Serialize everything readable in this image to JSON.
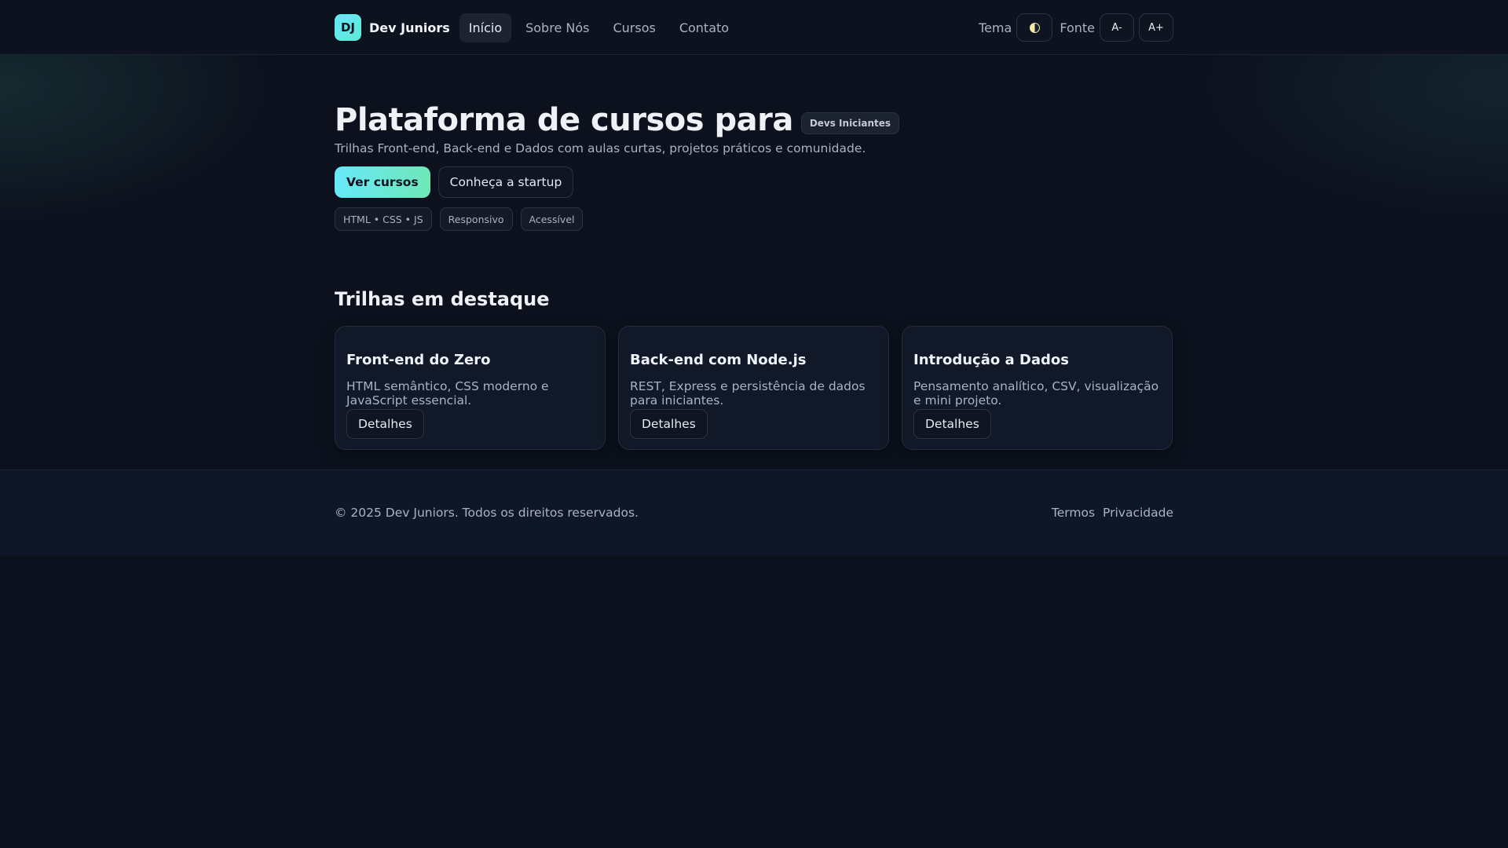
{
  "header": {
    "logo_text": "DJ",
    "brand": "Dev Juniors",
    "nav": [
      {
        "label": "Início"
      },
      {
        "label": "Sobre Nós"
      },
      {
        "label": "Cursos"
      },
      {
        "label": "Contato"
      }
    ],
    "theme_label": "Tema",
    "font_label": "Fonte",
    "font_decrease": "A-",
    "font_increase": "A+"
  },
  "hero": {
    "title": "Plataforma de cursos para",
    "badge": "Devs Iniciantes",
    "subtitle": "Trilhas Front-end, Back-end e Dados com aulas curtas, projetos práticos e comunidade.",
    "primary_button": "Ver cursos",
    "secondary_button": "Conheça a startup",
    "tags": [
      "HTML • CSS • JS",
      "Responsivo",
      "Acessível"
    ]
  },
  "featured": {
    "title": "Trilhas em destaque",
    "cards": [
      {
        "title": "Front-end do Zero",
        "desc": "HTML semântico, CSS moderno e JavaScript essencial.",
        "button": "Detalhes"
      },
      {
        "title": "Back-end com Node.js",
        "desc": "REST, Express e persistência de dados para iniciantes.",
        "button": "Detalhes"
      },
      {
        "title": "Introdução a Dados",
        "desc": "Pensamento analítico, CSV, visualização e mini projeto.",
        "button": "Detalhes"
      }
    ]
  },
  "footer": {
    "copyright": "© 2025 Dev Juniors. Todos os direitos reservados.",
    "links": [
      "Termos",
      "Privacidade"
    ]
  },
  "colors": {
    "background": "#0c111d",
    "accent_start": "#67e8f9",
    "accent_end": "#6ee7b7"
  }
}
